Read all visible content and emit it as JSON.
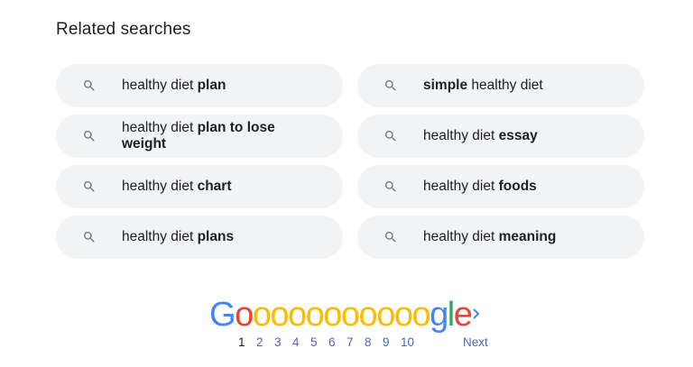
{
  "related": {
    "heading": "Related searches",
    "items": [
      {
        "normal": "healthy diet ",
        "bold": "plan",
        "suffix": ""
      },
      {
        "normal": "",
        "bold": "simple",
        "suffix": " healthy diet"
      },
      {
        "normal": "healthy diet ",
        "bold": "plan to lose weight",
        "suffix": ""
      },
      {
        "normal": "healthy diet ",
        "bold": "essay",
        "suffix": ""
      },
      {
        "normal": "healthy diet ",
        "bold": "chart",
        "suffix": ""
      },
      {
        "normal": "healthy diet ",
        "bold": "foods",
        "suffix": ""
      },
      {
        "normal": "healthy diet ",
        "bold": "plans",
        "suffix": ""
      },
      {
        "normal": "healthy diet ",
        "bold": "meaning",
        "suffix": ""
      }
    ],
    "icon": "search-icon"
  },
  "pagination": {
    "logo_letters": [
      "G",
      "o",
      "o",
      "o",
      "o",
      "o",
      "o",
      "o",
      "o",
      "o",
      "o",
      "o",
      "g",
      "l",
      "e"
    ],
    "pages": [
      "1",
      "2",
      "3",
      "4",
      "5",
      "6",
      "7",
      "8",
      "9",
      "10"
    ],
    "current_page": "1",
    "next_label": "Next",
    "next_icon": "chevron-right-icon"
  },
  "colors": {
    "pill_bg": "#f1f3f4",
    "link": "#4d67b5",
    "google_blue": "#4285f4",
    "google_red": "#ea4335",
    "google_yellow": "#fbbc05",
    "google_green": "#34a853"
  }
}
